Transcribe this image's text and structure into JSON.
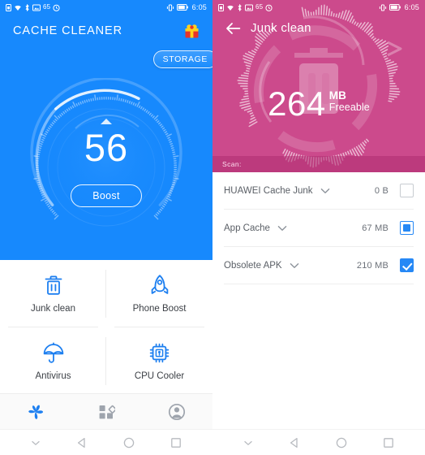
{
  "status_bar": {
    "battery_percent": "65",
    "time": "6:05",
    "icons": [
      "sim-card-icon",
      "wifi-icon",
      "bluetooth-icon",
      "screenshot-icon",
      "alarm-icon",
      "vibrate-icon",
      "battery-icon"
    ]
  },
  "left_screen": {
    "app_title": "CACHE CLEANER",
    "gift_icon": "gift-icon",
    "storage_button": "STORAGE",
    "gauge": {
      "value": "56",
      "boost_button": "Boost",
      "arc_percent": 56
    },
    "tiles": [
      {
        "label": "Junk clean",
        "icon": "trash-icon"
      },
      {
        "label": "Phone Boost",
        "icon": "rocket-icon"
      },
      {
        "label": "Antivirus",
        "icon": "umbrella-icon"
      },
      {
        "label": "CPU Cooler",
        "icon": "cpu-chip-icon"
      }
    ],
    "bottom_nav": [
      {
        "name": "home",
        "icon": "pinwheel-icon",
        "active": true
      },
      {
        "name": "tools",
        "icon": "grid-apps-icon",
        "active": false
      },
      {
        "name": "profile",
        "icon": "account-icon",
        "active": false
      }
    ]
  },
  "right_screen": {
    "back_icon": "back-arrow-icon",
    "page_title": "Junk clean",
    "freeable": {
      "amount": "264",
      "unit": "MB",
      "caption": "Freeable"
    },
    "scan_label": "Scan:",
    "rows": [
      {
        "label": "HUAWEI Cache Junk",
        "size": "0 B",
        "checkbox": "empty",
        "caret": "chevron-down-icon"
      },
      {
        "label": "App Cache",
        "size": "67 MB",
        "checkbox": "partial",
        "caret": "chevron-down-icon"
      },
      {
        "label": "Obsolete APK",
        "size": "210 MB",
        "checkbox": "checked",
        "caret": "chevron-down-icon"
      }
    ]
  },
  "android_nav": {
    "items": [
      "hide-navbar-icon",
      "back-icon",
      "home-icon",
      "recents-icon"
    ]
  },
  "colors": {
    "blue": "#1789fd",
    "pink": "#cc4a8c",
    "accent_blue": "#2688f5",
    "white": "#ffffff"
  }
}
